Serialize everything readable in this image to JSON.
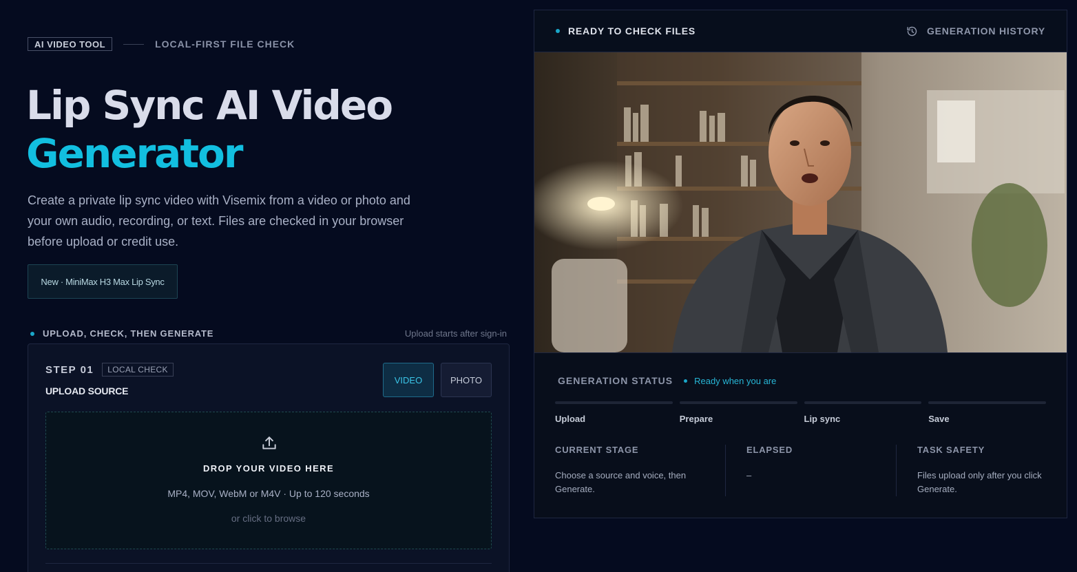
{
  "header": {
    "tag": "AI VIDEO TOOL",
    "subtag": "LOCAL-FIRST FILE CHECK"
  },
  "hero": {
    "title_line1": "Lip Sync AI Video",
    "title_line2": "Generator",
    "intro": "Create a private lip sync video with Visemix from a video or photo and your own audio, recording, or text. Files are checked in your browser before upload or credit use.",
    "badge_label": "New · MiniMax H3 Max Lip Sync"
  },
  "section": {
    "title": "UPLOAD, CHECK, THEN GENERATE",
    "note": "Upload starts after sign-in"
  },
  "step": {
    "number": "STEP 01",
    "tag": "LOCAL CHECK",
    "title": "UPLOAD SOURCE",
    "video_label": "VIDEO",
    "photo_label": "PHOTO",
    "selected": "VIDEO"
  },
  "dropzone": {
    "icon": "upload-icon",
    "title": "DROP YOUR VIDEO HERE",
    "formats": "MP4, MOV, WebM or M4V · Up to 120 seconds",
    "browse": "or click to browse"
  },
  "panel": {
    "ready_label": "READY TO CHECK FILES",
    "history_label": "GENERATION HISTORY",
    "history_icon": "history-icon",
    "status_label": "GENERATION STATUS",
    "status_value": "Ready when you are",
    "stages": [
      "Upload",
      "Prepare",
      "Lip sync",
      "Save"
    ],
    "current_stage_label": "CURRENT STAGE",
    "current_stage_text": "Choose a source and voice, then Generate.",
    "elapsed_label": "ELAPSED",
    "elapsed_value": "–",
    "task_safety_label": "TASK SAFETY",
    "task_safety_text": "Files upload only after you click Generate."
  },
  "colors": {
    "background": "#050b1f",
    "accent": "#12bfe0",
    "panel": "#070e1c"
  }
}
